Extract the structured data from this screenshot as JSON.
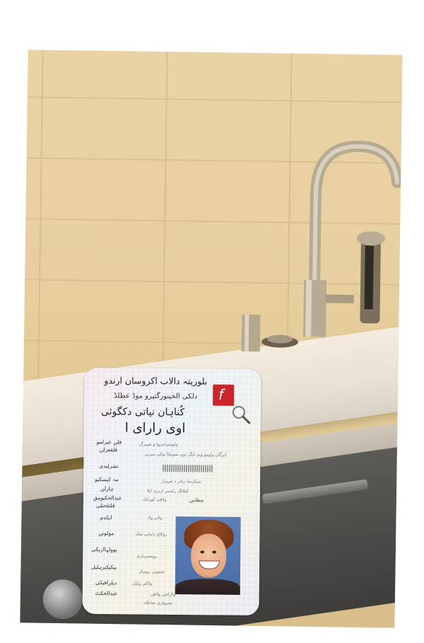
{
  "scene": {
    "description_icons": [
      "faucet-icon",
      "magnifier-icon",
      "flash-logo-icon"
    ]
  },
  "card": {
    "header_line_1": "بلوریتہ دالاب اکروسان ارندو",
    "header_line_2": "دلکی الحینورگتپرو موڈ عطلڈ",
    "title_line_1": "کُناہان نیاتی دکگوئی",
    "title_line_2": "اوی رارای ا",
    "labels": [
      "فلن عبرلمو",
      "قلقعزلن",
      "تشرلیدی",
      "مہ کیسکیو",
      "ہارلن",
      "عبدالحکیومق",
      "قلتلحنلی",
      "ایکدم",
      "مولوتن",
      "یوولہااریکی",
      "ییکیکیرہلیل",
      "دیلراقیکی",
      "عبدالحکٹ"
    ],
    "values": [
      "ولومنراندروا و شہرگر",
      "ایرگان ولومو ونو باپگ دوں سونیکا نوکی سرنی",
      "منیکرسا ریانر د شہزار",
      "کیلانگ راسمر اریری ایلا",
      "ولاقی کورانک",
      "چطاس",
      "ولانر ولا",
      "روکاچ رامایی شک",
      "روستیریاری",
      "شینونی روساز",
      "ولاکی وکیل",
      "ولاراچی ولاقی",
      "شیرواری شاتکلہ"
    ],
    "barcode_text": "ssssssssssssssssssssssssssssssssss"
  }
}
